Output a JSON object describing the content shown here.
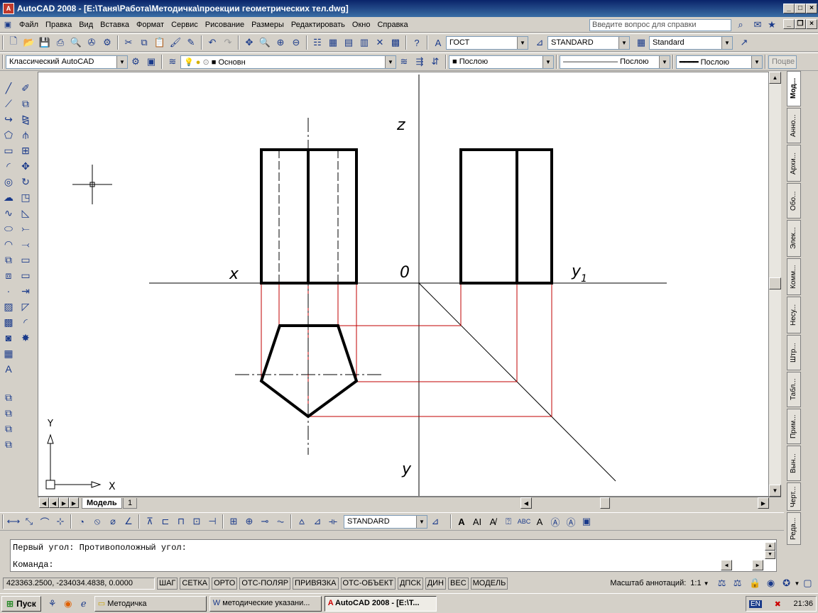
{
  "window": {
    "title": "AutoCAD 2008 - [E:\\Таня\\Работа\\Методичка\\проекции геометрических тел.dwg]",
    "app_icon": "A"
  },
  "menu": {
    "items": [
      "Файл",
      "Правка",
      "Вид",
      "Вставка",
      "Формат",
      "Сервис",
      "Рисование",
      "Размеры",
      "Редактировать",
      "Окно",
      "Справка"
    ],
    "help_placeholder": "Введите вопрос для справки"
  },
  "toolbar1": {
    "text_style": "ГОСТ",
    "dim_style": "STANDARD",
    "table_style": "Standard"
  },
  "toolbar2": {
    "workspace": "Классический AutoCAD",
    "layer": "Основн",
    "color": "Послою",
    "linetype": "Послою",
    "lineweight": "Послою",
    "plotstyle": "Поцве"
  },
  "drawing": {
    "labels": {
      "z": "z",
      "x": "x",
      "o": "0",
      "y1_main": "y",
      "y1_sub": "1",
      "y": "y"
    },
    "ucs": {
      "x": "X",
      "y": "Y"
    }
  },
  "tabs": {
    "model": "Модель",
    "layout1": "1"
  },
  "palette_tabs": [
    "Мод...",
    "Анно...",
    "Архи...",
    "Обо...",
    "Элек...",
    "Комм...",
    "Несу...",
    "Штр...",
    "Табл...",
    "Прим...",
    "Вын...",
    "Черт...",
    "Реда..."
  ],
  "dim_toolbar": {
    "dim_style": "STANDARD"
  },
  "command": {
    "history": "Первый угол: Противоположный угол:",
    "prompt": "Команда:"
  },
  "status": {
    "coords": "423363.2500, -234034.4838, 0.0000",
    "buttons": [
      "ШАГ",
      "СЕТКА",
      "ОРТО",
      "ОТС-ПОЛЯР",
      "ПРИВЯЗКА",
      "ОТС-ОБЪЕКТ",
      "ДПСК",
      "ДИН",
      "ВЕС",
      "МОДЕЛЬ"
    ],
    "annot_scale_label": "Масштаб аннотаций:",
    "annot_scale": "1:1"
  },
  "taskbar": {
    "start": "Пуск",
    "tasks": [
      "Методичка",
      "методические указани...",
      "AutoCAD 2008 - [E:\\Т..."
    ],
    "lang": "EN",
    "time": "21:36"
  }
}
